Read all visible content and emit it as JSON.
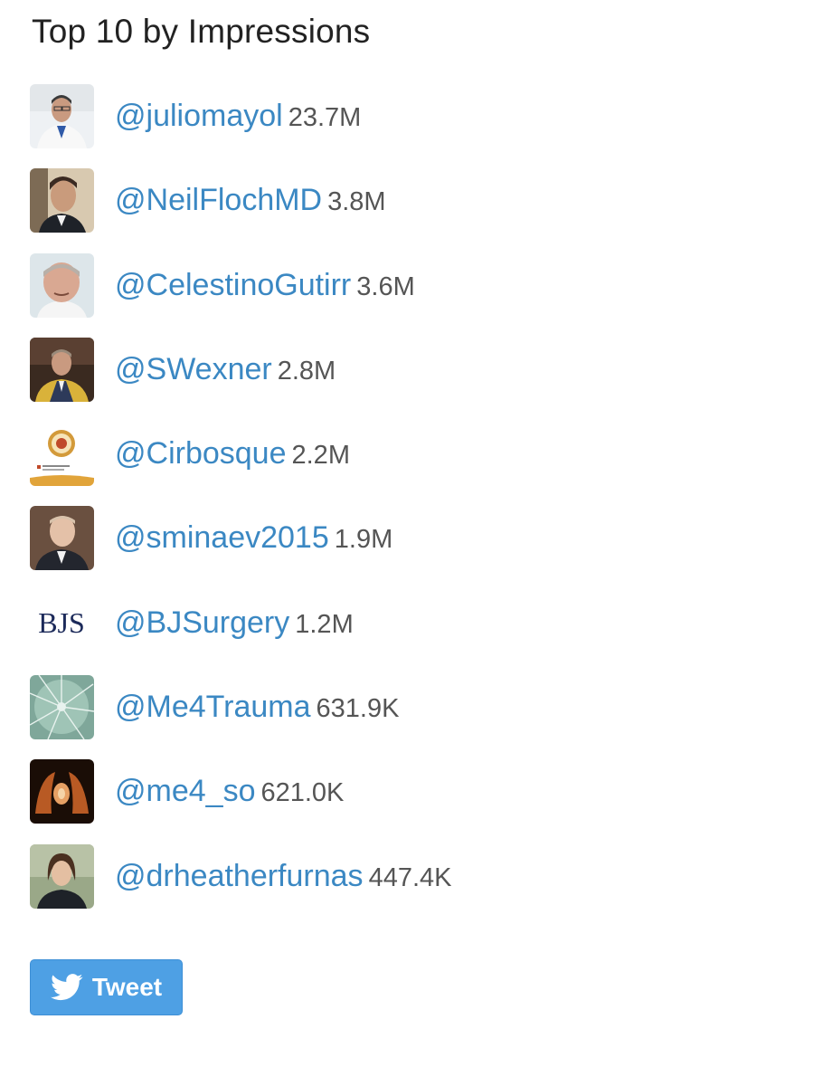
{
  "title": "Top 10 by Impressions",
  "accent_color": "#3b88c3",
  "button_color": "#4ea0e4",
  "rows": [
    {
      "handle": "@juliomayol",
      "count": "23.7M",
      "avatar": "doctor-portrait"
    },
    {
      "handle": "@NeilFlochMD",
      "count": "3.8M",
      "avatar": "man-portrait"
    },
    {
      "handle": "@CelestinoGutirr",
      "count": "3.6M",
      "avatar": "man-portrait"
    },
    {
      "handle": "@SWexner",
      "count": "2.8M",
      "avatar": "man-in-gown-portrait"
    },
    {
      "handle": "@Cirbosque",
      "count": "2.2M",
      "avatar": "university-logo"
    },
    {
      "handle": "@sminaev2015",
      "count": "1.9M",
      "avatar": "man-portrait"
    },
    {
      "handle": "@BJSurgery",
      "count": "1.2M",
      "avatar": "bjs-logo",
      "logo_text": "BJS"
    },
    {
      "handle": "@Me4Trauma",
      "count": "631.9K",
      "avatar": "cracked-glass-image"
    },
    {
      "handle": "@me4_so",
      "count": "621.0K",
      "avatar": "hands-image"
    },
    {
      "handle": "@drheatherfurnas",
      "count": "447.4K",
      "avatar": "woman-portrait"
    }
  ],
  "tweet_button": {
    "label": "Tweet",
    "icon": "twitter-bird-icon"
  }
}
